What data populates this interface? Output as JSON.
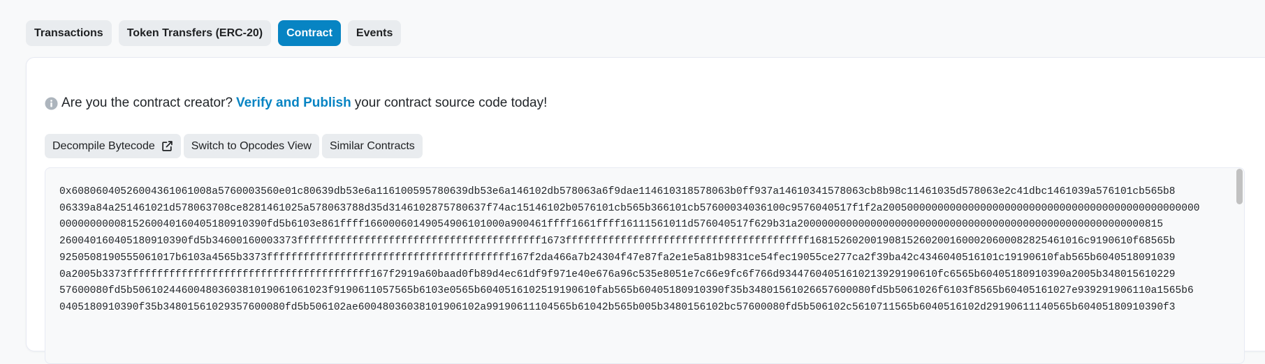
{
  "tabs": [
    {
      "label": "Transactions",
      "active": false
    },
    {
      "label": "Token Transfers (ERC-20)",
      "active": false
    },
    {
      "label": "Contract",
      "active": true
    },
    {
      "label": "Events",
      "active": false
    }
  ],
  "notice": {
    "prefix": "Are you the contract creator?",
    "link": "Verify and Publish",
    "suffix": "your contract source code today!",
    "icon": "info-circle-icon"
  },
  "buttons": {
    "decompile": "Decompile Bytecode",
    "decompile_icon": "external-link-icon",
    "opcodes": "Switch to Opcodes View",
    "similar": "Similar Contracts"
  },
  "bytecode_lines": [
    "0x6080604052600436106100 8a5760003560e01c80639db53e6a116100595780639db53e6a146102db578063a6f9dae114610318578063b0ff937a14610341578063cb8b98c11461035d578063e2c41dbc1461039a576101cb565b8",
    "06339a84a251461021d578063708ce8281461025a578063788d35d3146102875780637f74ac15146102b0576101cb565b366101cb57600034036100c9576040517f1f2a2005000000000000000000000000000000000000000000000000",
    "0000000000815260040160405180910390fd5b6103e861ffff16600060149054906101000a900461ffff1661ffff16111561011d576040517f629b31a200000000000000000000000000000000000000000000000000000000815",
    "26004016040518091039 0fd5b346001600033 73ffffffffffffffffffffffffffffffffffffffff1673ffffffffffffffffffffffffffffffffffffffff16815260200190815260200160002060008282546101 6c9190610f68565b",
    "9250508190555061017b6103a4565b3373ffffffffffffffffffffffffffffffffffffffff167f2da466a7b24304f47e87fa2e1e5a81b9831ce54fec19055ce277ca2f39ba42c4346040516101c19190610fab565b6040518091039",
    "0a2005b3373ffffffffffffffffffffffffffffffffffffffff167f2919a60baad0fb89d4ec61df9f971e40e676a96c535e8051e7c66e9fc6f766d93447604051610213929190610fc6565b60405180910390a2005b348015610229",
    "57600080fd5b506102446004803603810190610 61023f9190611057565b6103e0565b604051610251919061 0fab565b60405180910390f35b3480156102665 7600080fd5b5061026f6103f8565b60405161027e939291906110a1565b6",
    "0405180910390f35b3480156102935 7600080fd5b506102ae600480360381019061 02a99190611104565b61042b565b005b3480156102bc57600080fd5b506102c5610711565b6040516102d29190611140565b60405180910390f3"
  ],
  "colors": {
    "accent": "#0784c3",
    "tab_bg": "#e9ecef",
    "page_bg": "#f8f9fa"
  }
}
